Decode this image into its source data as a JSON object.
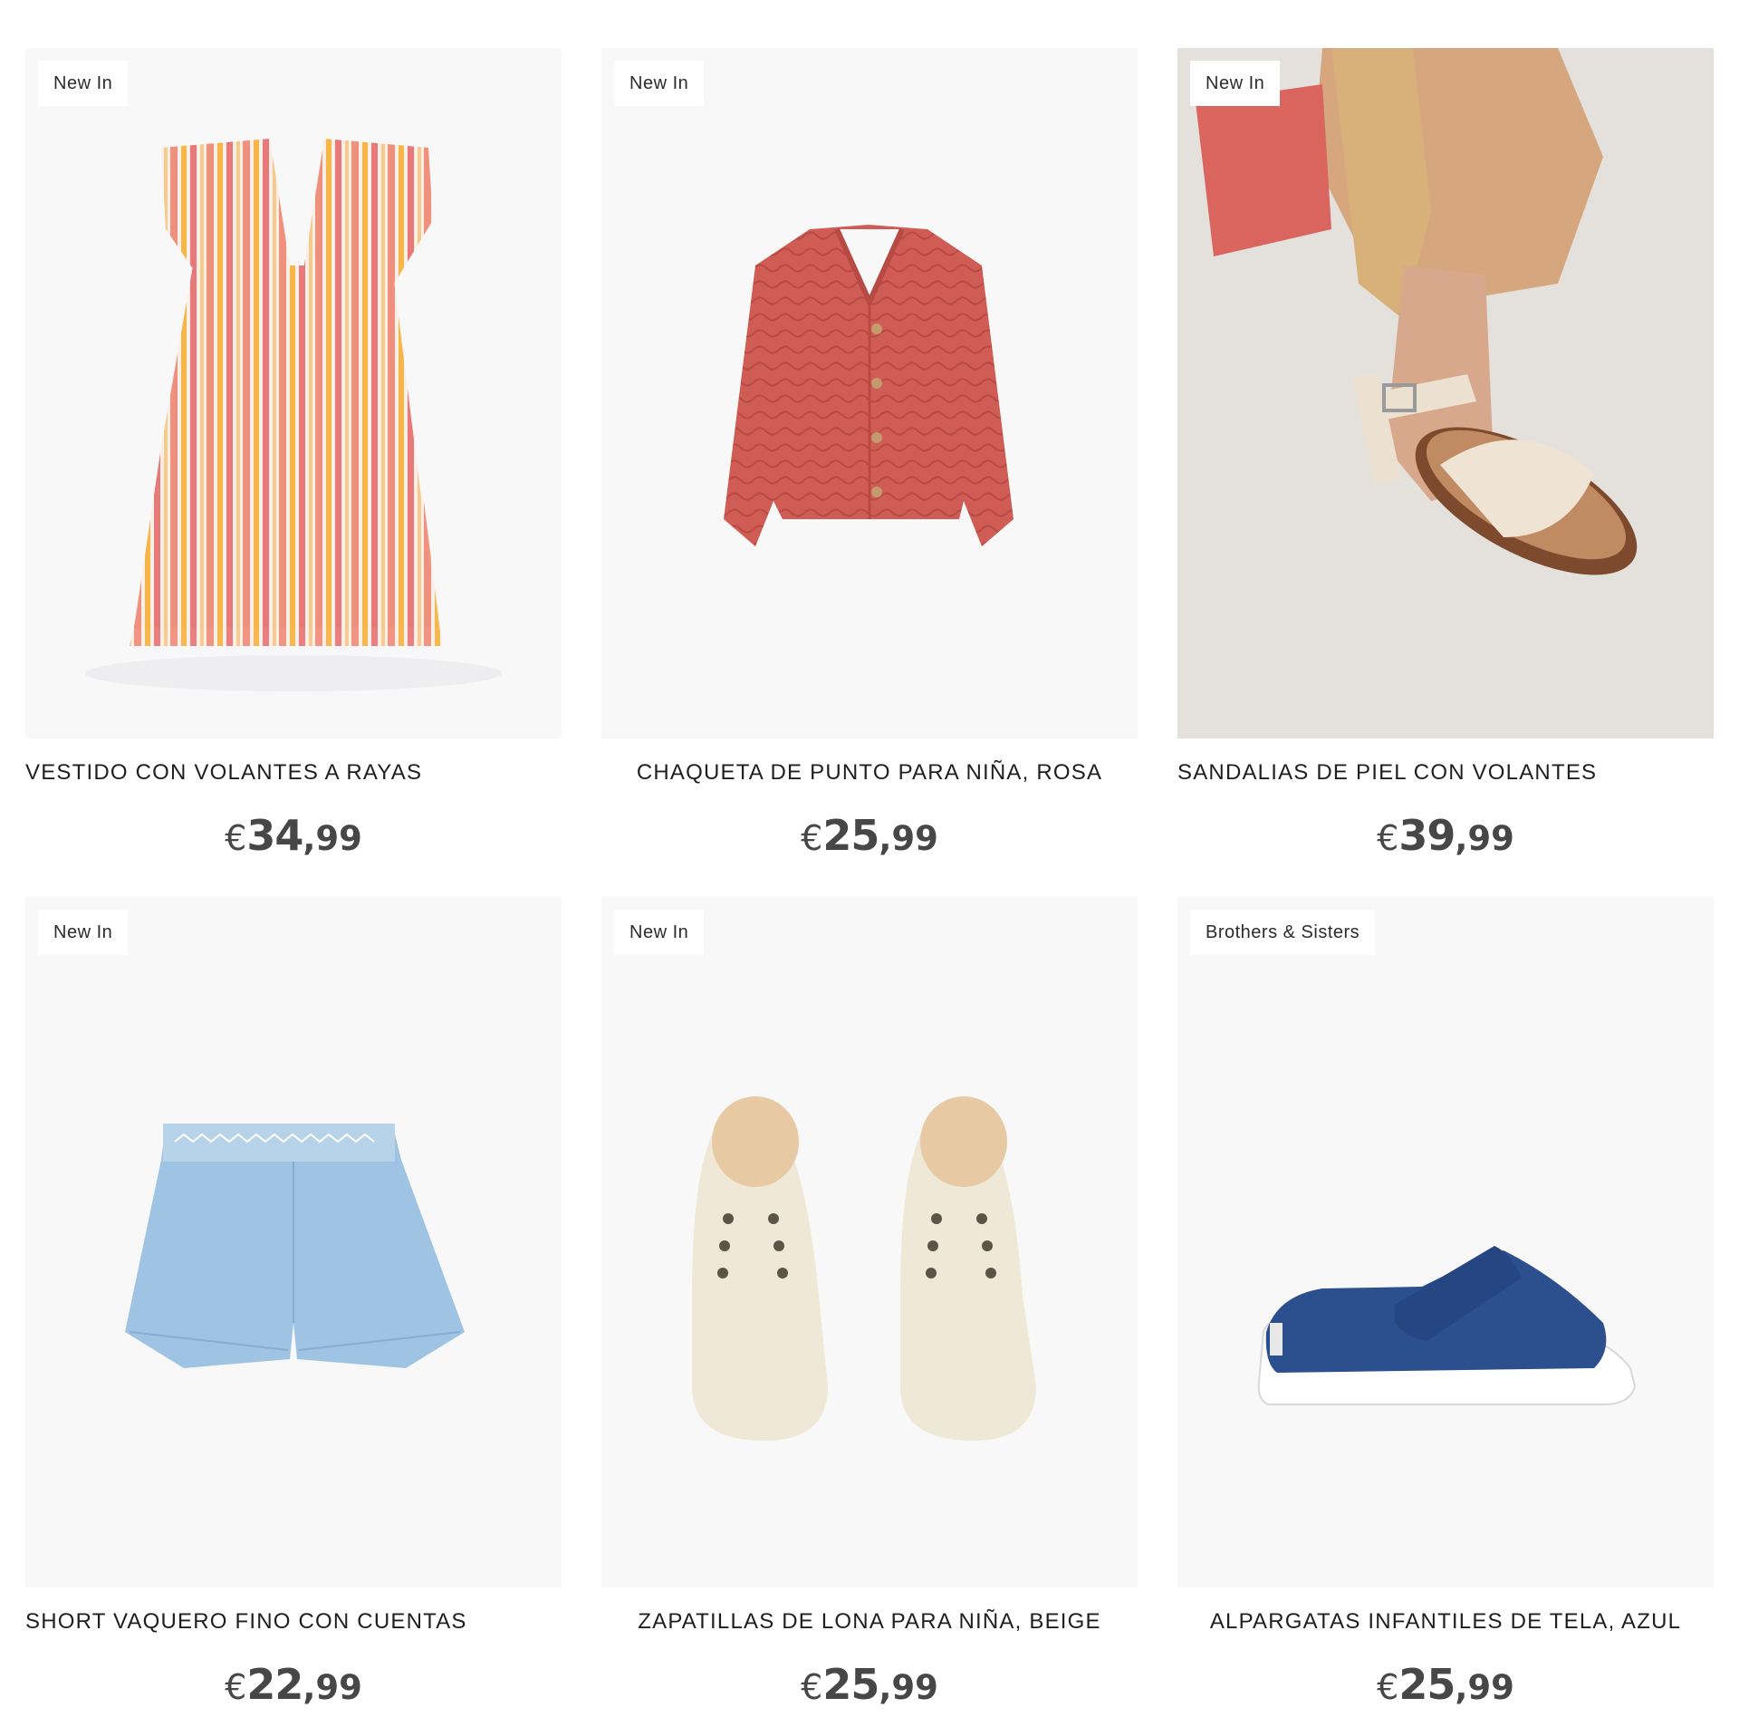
{
  "products": [
    {
      "badge": "New In",
      "name": "VESTIDO CON VOLANTES A RAYAS",
      "price": {
        "currency": "€",
        "int": "34",
        "dec": ",99"
      },
      "image": "striped-ruffle-dress-image"
    },
    {
      "badge": "New In",
      "name": "CHAQUETA DE PUNTO PARA NIÑA, ROSA",
      "price": {
        "currency": "€",
        "int": "25",
        "dec": ",99"
      },
      "image": "knit-cardigan-image"
    },
    {
      "badge": "New In",
      "name": "SANDALIAS DE PIEL CON VOLANTES",
      "price": {
        "currency": "€",
        "int": "39",
        "dec": ",99"
      },
      "image": "leather-ruffle-sandal-image"
    },
    {
      "badge": "New In",
      "name": "SHORT VAQUERO FINO CON CUENTAS",
      "price": {
        "currency": "€",
        "int": "22",
        "dec": ",99"
      },
      "image": "denim-shorts-image"
    },
    {
      "badge": "New In",
      "name": "ZAPATILLAS DE LONA PARA NIÑA, BEIGE",
      "price": {
        "currency": "€",
        "int": "25",
        "dec": ",99"
      },
      "image": "canvas-sneakers-image"
    },
    {
      "badge": "Brothers & Sisters",
      "name": "ALPARGATAS INFANTILES DE TELA, AZUL",
      "price": {
        "currency": "€",
        "int": "25",
        "dec": ",99"
      },
      "image": "blue-espadrille-image"
    }
  ],
  "colors": {
    "badge_bg": "#ffffff",
    "image_bg": "#f8f8f9",
    "price": "#474747",
    "text": "#1f1f1f"
  }
}
